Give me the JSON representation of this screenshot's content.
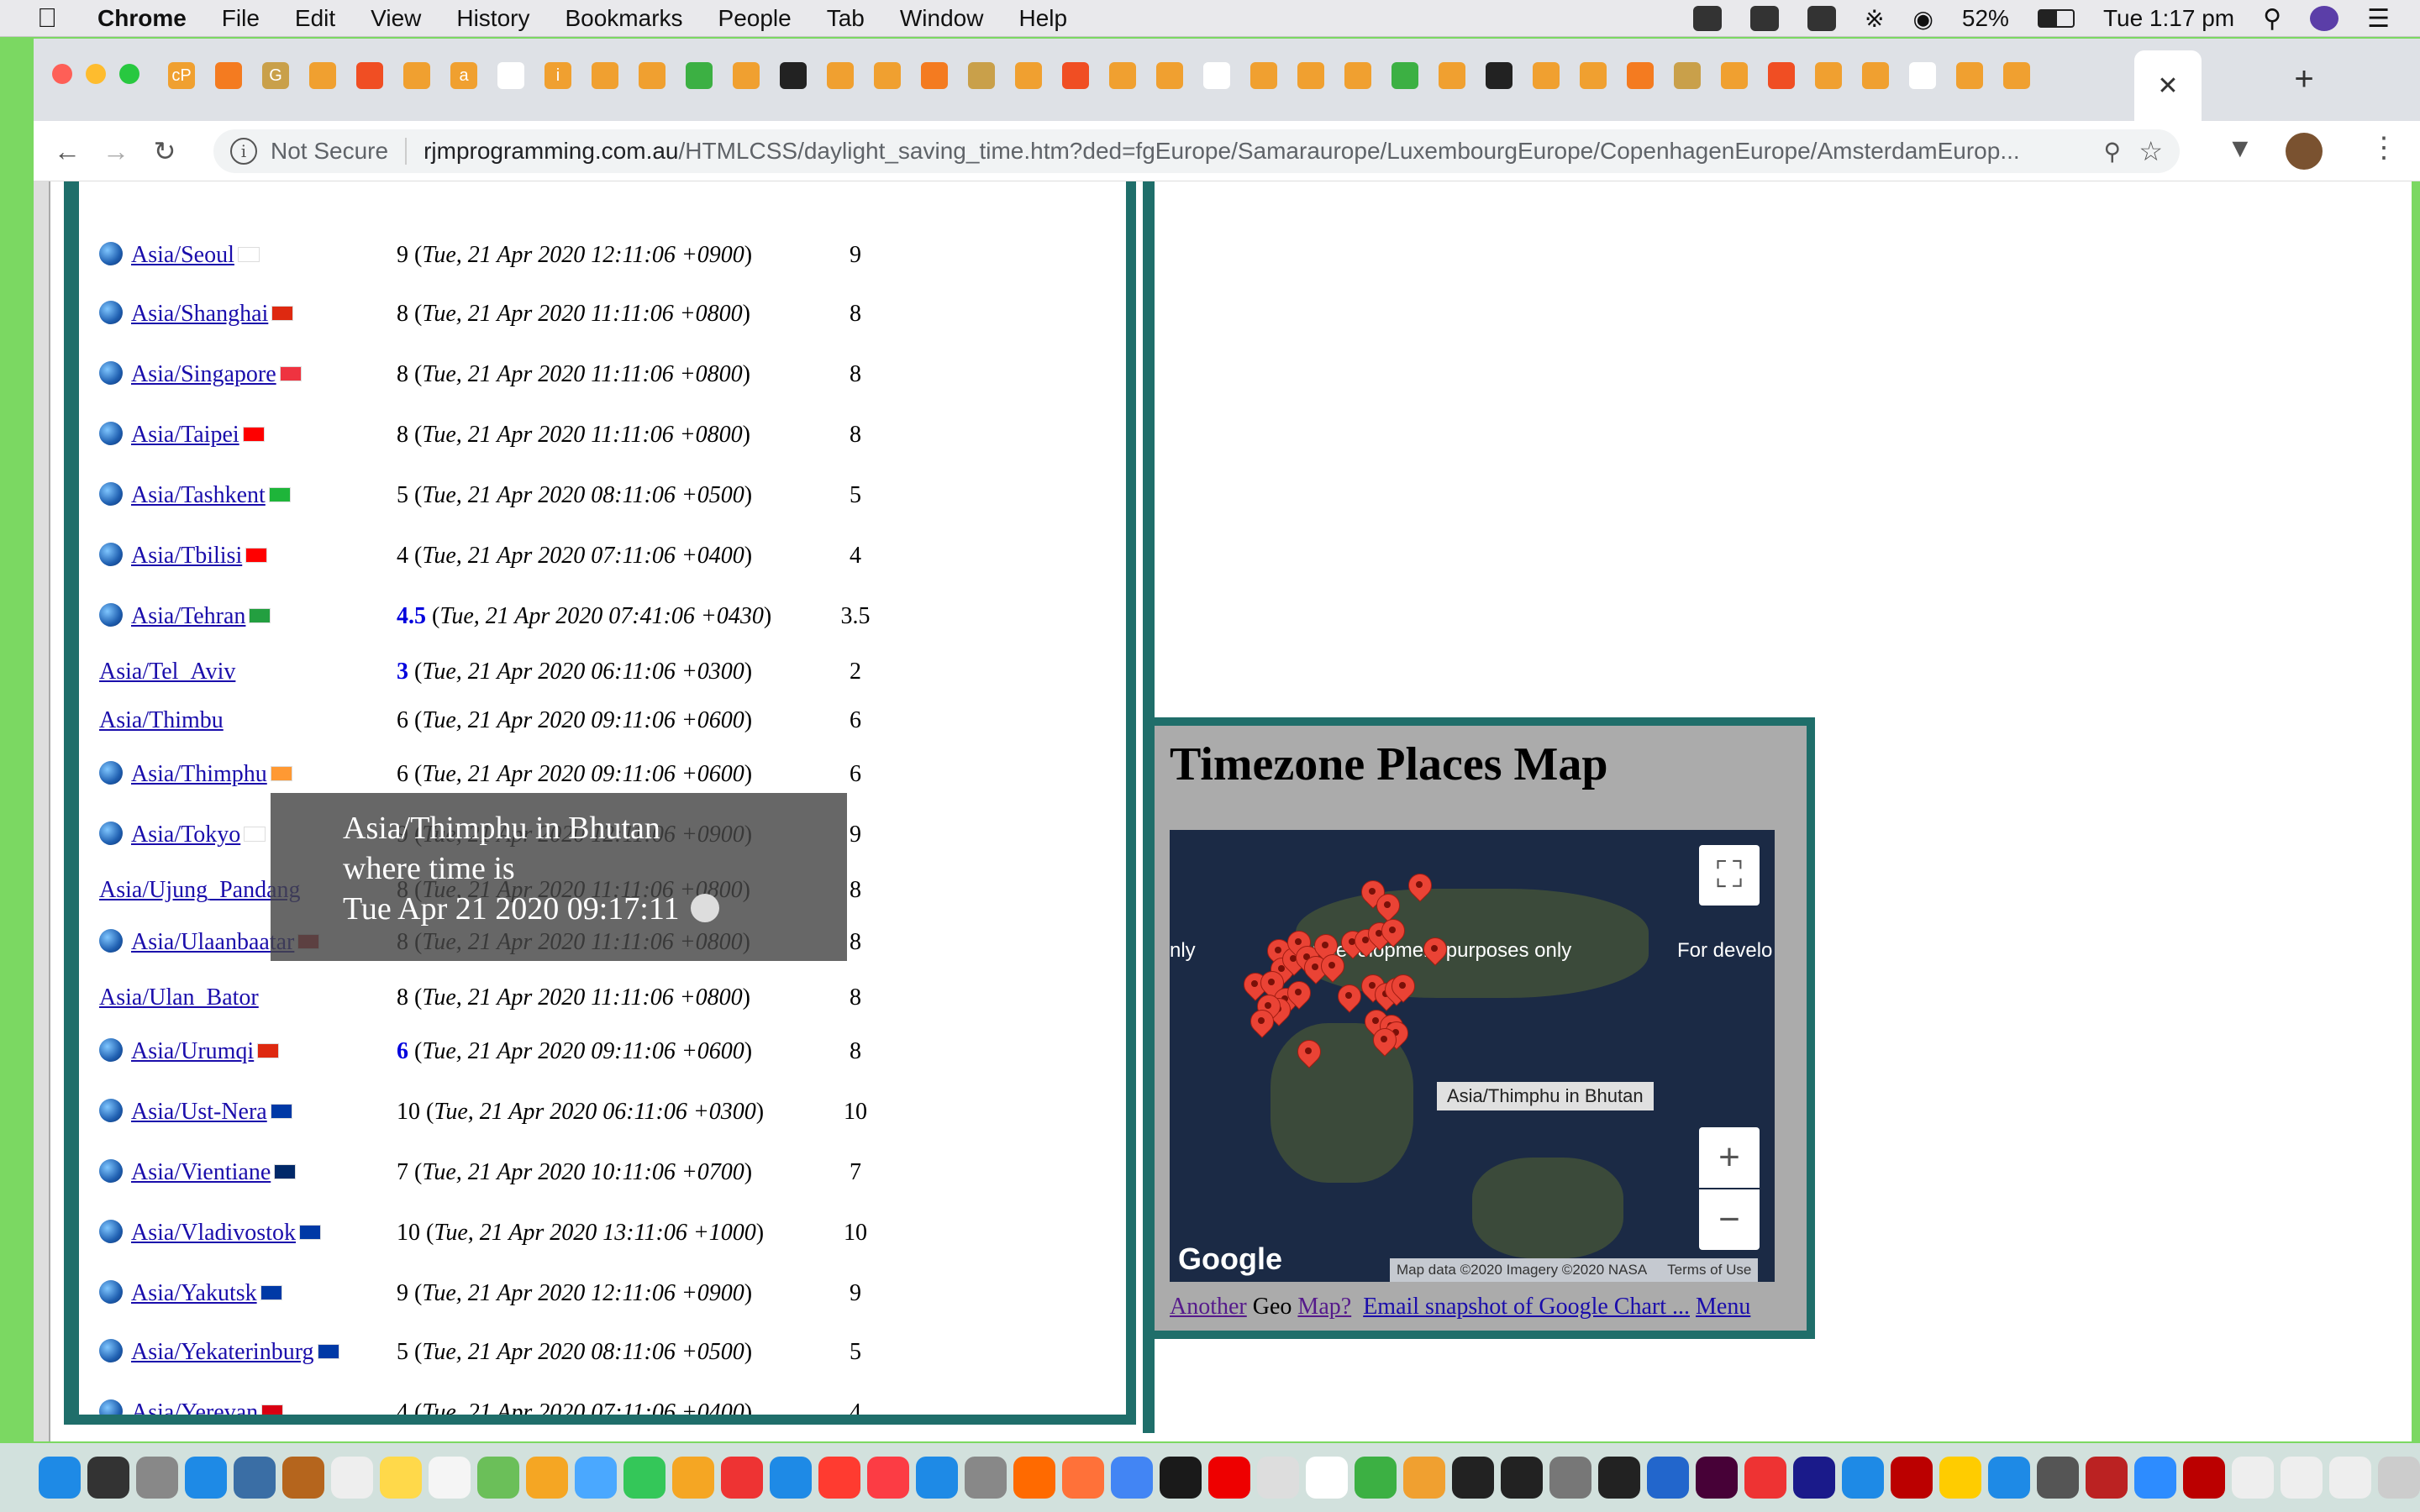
{
  "menubar": {
    "app": "Chrome",
    "items": [
      "File",
      "Edit",
      "View",
      "History",
      "Bookmarks",
      "People",
      "Tab",
      "Window",
      "Help"
    ],
    "battery": "52%",
    "clock": "Tue 1:17 pm"
  },
  "browser": {
    "not_secure": "Not Secure",
    "url_host": "rjmprogramming.com.au",
    "url_path": "/HTMLCSS/daylight_saving_time.htm?ded=fgEurope/Samaraurope/LuxembourgEurope/CopenhagenEurope/AmsterdamEurop...",
    "favicon_letters": [
      "cP",
      "",
      "G",
      "",
      "",
      "",
      "a",
      "",
      "i",
      "",
      "",
      "",
      "",
      "",
      ""
    ]
  },
  "timezones": [
    {
      "place": "Asia/Seoul",
      "globe": true,
      "flag_color": "#fff",
      "offset": "9",
      "offset_hl": false,
      "datetime": "Tue, 21 Apr 2020 12:11:06 +0900",
      "std": "9"
    },
    {
      "place": "Asia/Shanghai",
      "globe": true,
      "flag_color": "#de2910",
      "offset": "8",
      "offset_hl": false,
      "datetime": "Tue, 21 Apr 2020 11:11:06 +0800",
      "std": "8"
    },
    {
      "place": "Asia/Singapore",
      "globe": true,
      "flag_color": "#ef3340",
      "offset": "8",
      "offset_hl": false,
      "datetime": "Tue, 21 Apr 2020 11:11:06 +0800",
      "std": "8"
    },
    {
      "place": "Asia/Taipei",
      "globe": true,
      "flag_color": "#fe0000",
      "offset": "8",
      "offset_hl": false,
      "datetime": "Tue, 21 Apr 2020 11:11:06 +0800",
      "std": "8"
    },
    {
      "place": "Asia/Tashkent",
      "globe": true,
      "flag_color": "#1eb53a",
      "offset": "5",
      "offset_hl": false,
      "datetime": "Tue, 21 Apr 2020 08:11:06 +0500",
      "std": "5"
    },
    {
      "place": "Asia/Tbilisi",
      "globe": true,
      "flag_color": "#ff0000",
      "offset": "4",
      "offset_hl": false,
      "datetime": "Tue, 21 Apr 2020 07:11:06 +0400",
      "std": "4"
    },
    {
      "place": "Asia/Tehran",
      "globe": true,
      "flag_color": "#239f40",
      "offset": "4.5",
      "offset_hl": true,
      "datetime": "Tue, 21 Apr 2020 07:41:06 +0430",
      "std": "3.5"
    },
    {
      "place": "Asia/Tel_Aviv",
      "globe": false,
      "flag_color": "",
      "offset": "3",
      "offset_hl": true,
      "datetime": "Tue, 21 Apr 2020 06:11:06 +0300",
      "std": "2"
    },
    {
      "place": "Asia/Thimbu",
      "globe": false,
      "flag_color": "",
      "offset": "6",
      "offset_hl": false,
      "datetime": "Tue, 21 Apr 2020 09:11:06 +0600",
      "std": "6"
    },
    {
      "place": "Asia/Thimphu",
      "globe": true,
      "flag_color": "#ff9933",
      "offset": "6",
      "offset_hl": false,
      "datetime": "Tue, 21 Apr 2020 09:11:06 +0600",
      "std": "6"
    },
    {
      "place": "Asia/Tokyo",
      "globe": true,
      "flag_color": "#fff",
      "offset": "9",
      "offset_hl": false,
      "datetime": "Tue, 21 Apr 2020 12:11:06 +0900",
      "std": "9"
    },
    {
      "place": "Asia/Ujung_Pandang",
      "globe": false,
      "flag_color": "",
      "offset": "8",
      "offset_hl": false,
      "datetime": "Tue, 21 Apr 2020 11:11:06 +0800",
      "std": "8"
    },
    {
      "place": "Asia/Ulaanbaatar",
      "globe": true,
      "flag_color": "#c4272f",
      "offset": "8",
      "offset_hl": false,
      "datetime": "Tue, 21 Apr 2020 11:11:06 +0800",
      "std": "8"
    },
    {
      "place": "Asia/Ulan_Bator",
      "globe": false,
      "flag_color": "",
      "offset": "8",
      "offset_hl": false,
      "datetime": "Tue, 21 Apr 2020 11:11:06 +0800",
      "std": "8"
    },
    {
      "place": "Asia/Urumqi",
      "globe": true,
      "flag_color": "#de2910",
      "offset": "6",
      "offset_hl": true,
      "datetime": "Tue, 21 Apr 2020 09:11:06 +0600",
      "std": "8"
    },
    {
      "place": "Asia/Ust-Nera",
      "globe": true,
      "flag_color": "#0039a6",
      "offset": "10",
      "offset_hl": false,
      "datetime": "Tue, 21 Apr 2020 06:11:06 +0300",
      "std": "10"
    },
    {
      "place": "Asia/Vientiane",
      "globe": true,
      "flag_color": "#002868",
      "offset": "7",
      "offset_hl": false,
      "datetime": "Tue, 21 Apr 2020 10:11:06 +0700",
      "std": "7"
    },
    {
      "place": "Asia/Vladivostok",
      "globe": true,
      "flag_color": "#0039a6",
      "offset": "10",
      "offset_hl": false,
      "datetime": "Tue, 21 Apr 2020 13:11:06 +1000",
      "std": "10"
    },
    {
      "place": "Asia/Yakutsk",
      "globe": true,
      "flag_color": "#0039a6",
      "offset": "9",
      "offset_hl": false,
      "datetime": "Tue, 21 Apr 2020 12:11:06 +0900",
      "std": "9"
    },
    {
      "place": "Asia/Yekaterinburg",
      "globe": true,
      "flag_color": "#0039a6",
      "offset": "5",
      "offset_hl": false,
      "datetime": "Tue, 21 Apr 2020 08:11:06 +0500",
      "std": "5"
    },
    {
      "place": "Asia/Yerevan",
      "globe": true,
      "flag_color": "#d90012",
      "offset": "4",
      "offset_hl": false,
      "datetime": "Tue, 21 Apr 2020 07:11:06 +0400",
      "std": "4"
    }
  ],
  "tooltip": {
    "line1": "Asia/Thimphu in Bhutan",
    "line2": "where time is",
    "line3": "Tue Apr 21 2020 09:17:11"
  },
  "map": {
    "title": "Timezone Places Map",
    "dev_text_left": "nly",
    "dev_text_mid": "For development purposes only",
    "dev_text_right": "For develo",
    "marker_label": "Asia/Thimphu in Bhutan",
    "google": "Google",
    "attribution": "Map data ©2020 Imagery ©2020 NASA",
    "terms": "Terms of Use",
    "zoom_in": "+",
    "zoom_out": "−",
    "links": {
      "another": "Another",
      "geo": "Geo",
      "map": "Map?",
      "email": "Email snapshot of Google Chart ...",
      "menu": "Menu"
    }
  }
}
